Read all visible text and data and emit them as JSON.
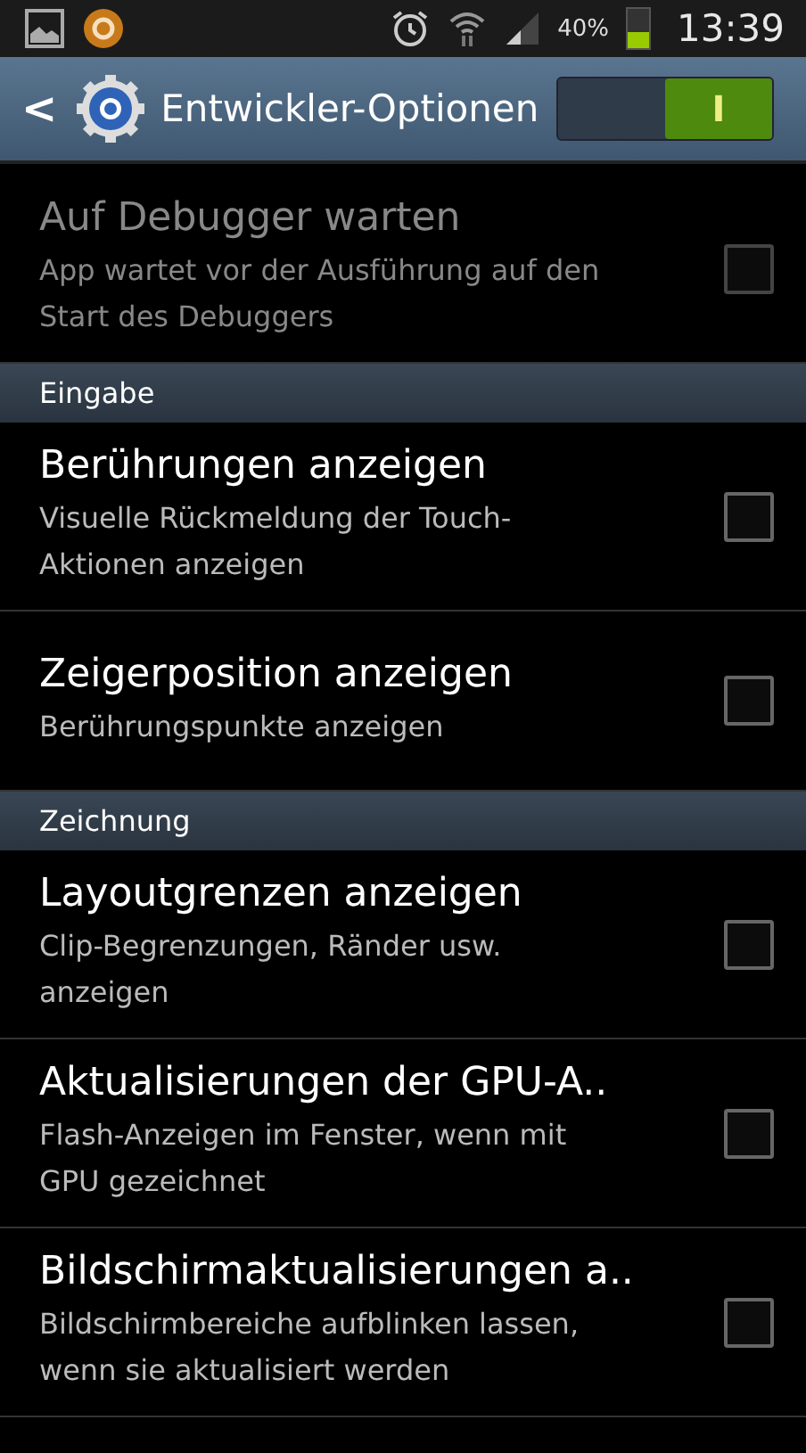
{
  "status_bar": {
    "battery": "40%",
    "battery_icon": {
      "level": 0.4
    },
    "time": "13:39"
  },
  "action_bar": {
    "title": "Entwickler-Optionen",
    "back": "<",
    "switch": {
      "on": true,
      "label": "I"
    }
  },
  "items": [
    {
      "kind": "checkbox",
      "title": "Auf Debugger warten",
      "summary": "App wartet vor der Ausführung auf den Start des Debuggers",
      "disabled": true,
      "checked": false
    },
    {
      "kind": "header",
      "title": "Eingabe"
    },
    {
      "kind": "checkbox",
      "title": "Berührungen anzeigen",
      "summary": "Visuelle Rückmeldung der Touch-Aktionen anzeigen",
      "disabled": false,
      "checked": false
    },
    {
      "kind": "checkbox",
      "title": "Zeigerposition anzeigen",
      "summary": "Berührungspunkte anzeigen",
      "disabled": false,
      "checked": false
    },
    {
      "kind": "header",
      "title": "Zeichnung"
    },
    {
      "kind": "checkbox",
      "title": "Layoutgrenzen anzeigen",
      "summary": "Clip-Begrenzungen, Ränder usw. anzeigen",
      "disabled": false,
      "checked": false
    },
    {
      "kind": "checkbox",
      "title": "Aktualisierungen der GPU-A..",
      "summary": "Flash-Anzeigen im Fenster, wenn mit GPU gezeichnet",
      "disabled": false,
      "checked": false
    },
    {
      "kind": "checkbox",
      "title": "Bildschirmaktualisierungen a..",
      "summary": "Bildschirmbereiche aufblinken lassen, wenn sie aktualisiert werden",
      "disabled": false,
      "checked": false
    }
  ]
}
